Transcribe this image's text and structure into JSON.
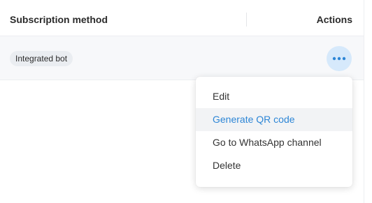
{
  "table": {
    "headers": {
      "subscription_method": "Subscription method",
      "actions": "Actions"
    },
    "rows": [
      {
        "method": "Integrated bot"
      }
    ]
  },
  "actions_menu": {
    "items": [
      {
        "label": "Edit",
        "highlighted": false
      },
      {
        "label": "Generate QR code",
        "highlighted": true
      },
      {
        "label": "Go to WhatsApp channel",
        "highlighted": false
      },
      {
        "label": "Delete",
        "highlighted": false
      }
    ]
  },
  "colors": {
    "accent": "#2d86d6",
    "more_button_bg": "#d6e9fb",
    "row_bg": "#f7f8fa",
    "badge_bg": "#eaedf1"
  },
  "icons": {
    "more": "more-horizontal-icon"
  }
}
